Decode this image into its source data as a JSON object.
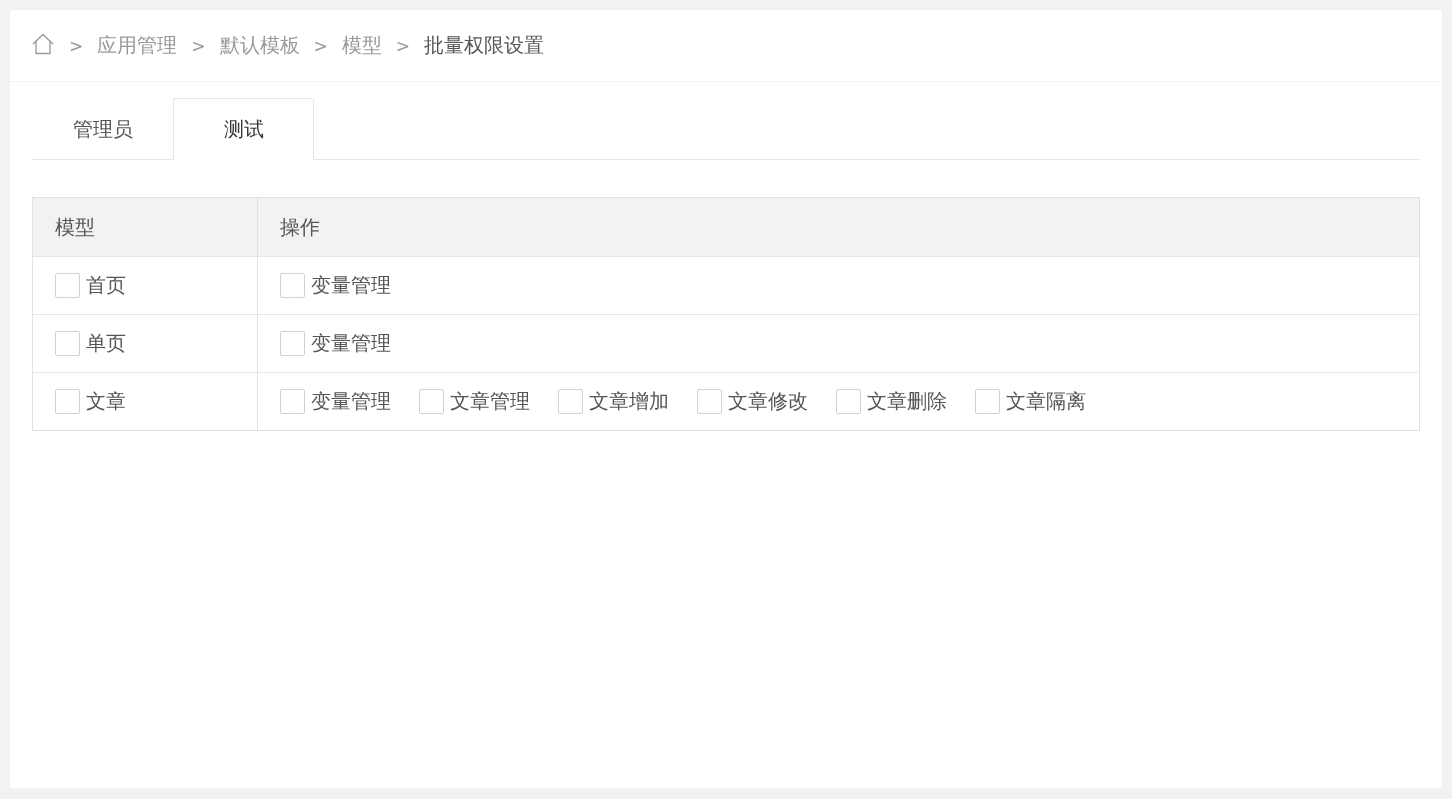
{
  "breadcrumb": [
    {
      "kind": "home"
    },
    {
      "kind": "separator",
      "text": ">"
    },
    {
      "kind": "link",
      "text": "应用管理"
    },
    {
      "kind": "separator",
      "text": ">"
    },
    {
      "kind": "link",
      "text": "默认模板"
    },
    {
      "kind": "separator",
      "text": ">"
    },
    {
      "kind": "link",
      "text": "模型"
    },
    {
      "kind": "separator",
      "text": ">"
    },
    {
      "kind": "current",
      "text": "批量权限设置"
    }
  ],
  "tabs": [
    {
      "label": "管理员",
      "selected": false
    },
    {
      "label": "测试",
      "selected": true
    }
  ],
  "table": {
    "columns": [
      "模型",
      "操作"
    ],
    "rows": [
      {
        "model": {
          "label": "首页",
          "checked": false
        },
        "operations": [
          {
            "label": "变量管理",
            "checked": false
          }
        ]
      },
      {
        "model": {
          "label": "单页",
          "checked": false
        },
        "operations": [
          {
            "label": "变量管理",
            "checked": false
          }
        ]
      },
      {
        "model": {
          "label": "文章",
          "checked": false
        },
        "operations": [
          {
            "label": "变量管理",
            "checked": false
          },
          {
            "label": "文章管理",
            "checked": false
          },
          {
            "label": "文章增加",
            "checked": false
          },
          {
            "label": "文章修改",
            "checked": false
          },
          {
            "label": "文章删除",
            "checked": false
          },
          {
            "label": "文章隔离",
            "checked": false
          }
        ]
      }
    ]
  }
}
